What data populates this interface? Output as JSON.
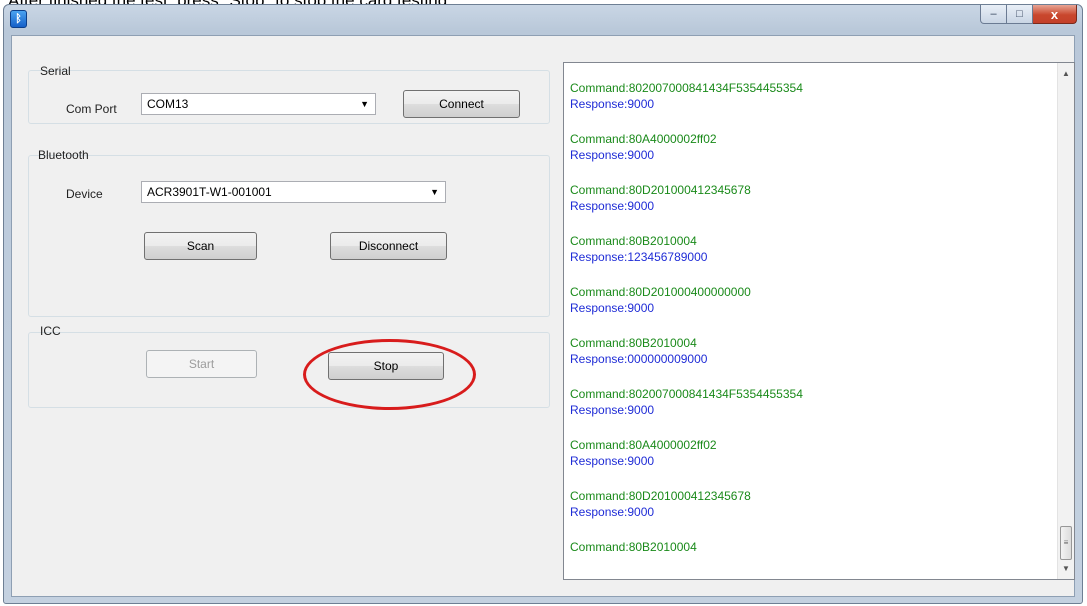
{
  "caption": "After finished the test, press \"Stop\" to stop the card testing.",
  "window": {
    "icon": "bluetooth-icon",
    "controls": {
      "minimize": "–",
      "maximize": "□",
      "close": "x"
    }
  },
  "serial": {
    "group_label": "Serial",
    "com_port_label": "Com Port",
    "com_port_value": "COM13",
    "connect_label": "Connect"
  },
  "bluetooth": {
    "group_label": "Bluetooth",
    "device_label": "Device",
    "device_value": "ACR3901T-W1-001001",
    "scan_label": "Scan",
    "disconnect_label": "Disconnect"
  },
  "icc": {
    "group_label": "ICC",
    "start_label": "Start",
    "start_enabled": false,
    "stop_label": "Stop",
    "highlight_color": "#d81c1c"
  },
  "log": {
    "command_color": "#1a8a1a",
    "response_color": "#1f2cd6",
    "entries": [
      {
        "command": "Command:802007000841434F5354455354",
        "response": "Response:9000"
      },
      {
        "command": "Command:80A4000002ff02",
        "response": "Response:9000"
      },
      {
        "command": "Command:80D201000412345678",
        "response": "Response:9000"
      },
      {
        "command": "Command:80B2010004",
        "response": "Response:123456789000"
      },
      {
        "command": "Command:80D201000400000000",
        "response": "Response:9000"
      },
      {
        "command": "Command:80B2010004",
        "response": "Response:000000009000"
      },
      {
        "command": "Command:802007000841434F5354455354",
        "response": "Response:9000"
      },
      {
        "command": "Command:80A4000002ff02",
        "response": "Response:9000"
      },
      {
        "command": "Command:80D201000412345678",
        "response": "Response:9000"
      },
      {
        "command": "Command:80B2010004",
        "response": ""
      }
    ],
    "scroll_up_glyph": "▲",
    "scroll_down_glyph": "▼",
    "thumb_glyph": "≡"
  }
}
